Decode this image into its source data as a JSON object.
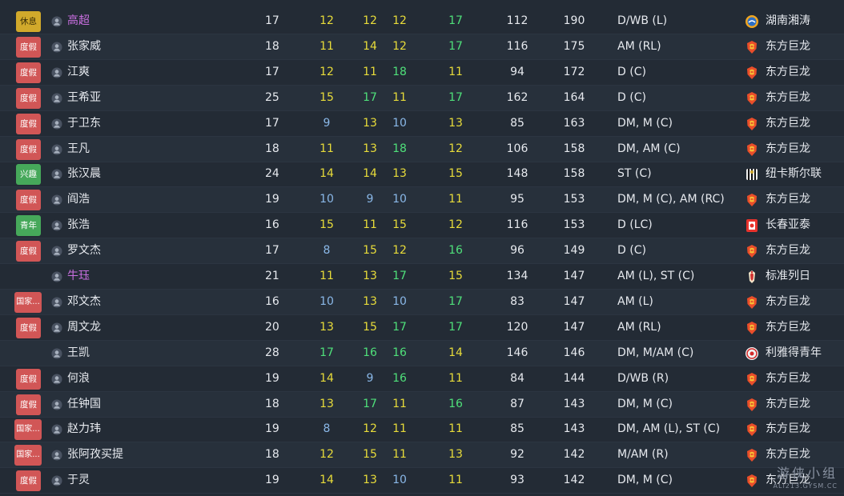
{
  "rows": [
    {
      "badge": "休息",
      "badge_type": "rest",
      "name": "高超",
      "purple": true,
      "age": "17",
      "a1": "12",
      "a1c": "yellow",
      "a2": "12",
      "a2c": "yellow",
      "a3": "12",
      "a3c": "yellow",
      "a4": "17",
      "a4c": "green",
      "v1": "112",
      "v2": "190",
      "pos": "D/WB (L)",
      "club": "湖南湘涛",
      "club_icon": "xiangtao"
    },
    {
      "badge": "度假",
      "badge_type": "vac",
      "name": "张家威",
      "purple": false,
      "age": "18",
      "a1": "11",
      "a1c": "yellow",
      "a2": "14",
      "a2c": "yellow",
      "a3": "12",
      "a3c": "yellow",
      "a4": "17",
      "a4c": "green",
      "v1": "116",
      "v2": "175",
      "pos": "AM (RL)",
      "club": "东方巨龙",
      "club_icon": "dragon"
    },
    {
      "badge": "度假",
      "badge_type": "vac",
      "name": "江爽",
      "purple": false,
      "age": "17",
      "a1": "12",
      "a1c": "yellow",
      "a2": "11",
      "a2c": "yellow",
      "a3": "18",
      "a3c": "green",
      "a4": "11",
      "a4c": "yellow",
      "v1": "94",
      "v2": "172",
      "pos": "D (C)",
      "club": "东方巨龙",
      "club_icon": "dragon"
    },
    {
      "badge": "度假",
      "badge_type": "vac",
      "name": "王希亚",
      "purple": false,
      "age": "25",
      "a1": "15",
      "a1c": "yellow",
      "a2": "17",
      "a2c": "green",
      "a3": "11",
      "a3c": "yellow",
      "a4": "17",
      "a4c": "green",
      "v1": "162",
      "v2": "164",
      "pos": "D (C)",
      "club": "东方巨龙",
      "club_icon": "dragon"
    },
    {
      "badge": "度假",
      "badge_type": "vac",
      "name": "于卫东",
      "purple": false,
      "age": "17",
      "a1": "9",
      "a1c": "blue",
      "a2": "13",
      "a2c": "yellow",
      "a3": "10",
      "a3c": "blue",
      "a4": "13",
      "a4c": "yellow",
      "v1": "85",
      "v2": "163",
      "pos": "DM, M (C)",
      "club": "东方巨龙",
      "club_icon": "dragon"
    },
    {
      "badge": "度假",
      "badge_type": "vac",
      "name": "王凡",
      "purple": false,
      "age": "18",
      "a1": "11",
      "a1c": "yellow",
      "a2": "13",
      "a2c": "yellow",
      "a3": "18",
      "a3c": "green",
      "a4": "12",
      "a4c": "yellow",
      "v1": "106",
      "v2": "158",
      "pos": "DM, AM (C)",
      "club": "东方巨龙",
      "club_icon": "dragon"
    },
    {
      "badge": "兴趣",
      "badge_type": "int",
      "name": "张汉晨",
      "purple": false,
      "age": "24",
      "a1": "14",
      "a1c": "yellow",
      "a2": "14",
      "a2c": "yellow",
      "a3": "13",
      "a3c": "yellow",
      "a4": "15",
      "a4c": "yellow",
      "v1": "148",
      "v2": "158",
      "pos": "ST (C)",
      "club": "纽卡斯尔联",
      "club_icon": "newcastle"
    },
    {
      "badge": "度假",
      "badge_type": "vac",
      "name": "阎浩",
      "purple": false,
      "age": "19",
      "a1": "10",
      "a1c": "blue",
      "a2": "9",
      "a2c": "blue",
      "a3": "10",
      "a3c": "blue",
      "a4": "11",
      "a4c": "yellow",
      "v1": "95",
      "v2": "153",
      "pos": "DM, M (C), AM (RC)",
      "club": "东方巨龙",
      "club_icon": "dragon"
    },
    {
      "badge": "青年",
      "badge_type": "youth",
      "name": "张浩",
      "purple": false,
      "age": "16",
      "a1": "15",
      "a1c": "yellow",
      "a2": "11",
      "a2c": "yellow",
      "a3": "15",
      "a3c": "yellow",
      "a4": "12",
      "a4c": "yellow",
      "v1": "116",
      "v2": "153",
      "pos": "D (LC)",
      "club": "长春亚泰",
      "club_icon": "yatai"
    },
    {
      "badge": "度假",
      "badge_type": "vac",
      "name": "罗文杰",
      "purple": false,
      "age": "17",
      "a1": "8",
      "a1c": "blue",
      "a2": "15",
      "a2c": "yellow",
      "a3": "12",
      "a3c": "yellow",
      "a4": "16",
      "a4c": "green",
      "v1": "96",
      "v2": "149",
      "pos": "D (C)",
      "club": "东方巨龙",
      "club_icon": "dragon"
    },
    {
      "badge": "",
      "badge_type": "",
      "name": "牛珏",
      "purple": true,
      "age": "21",
      "a1": "11",
      "a1c": "yellow",
      "a2": "13",
      "a2c": "yellow",
      "a3": "17",
      "a3c": "green",
      "a4": "15",
      "a4c": "yellow",
      "v1": "134",
      "v2": "147",
      "pos": "AM (L), ST (C)",
      "club": "标准列日",
      "club_icon": "liege"
    },
    {
      "badge": "国家...",
      "badge_type": "intl",
      "name": "邓文杰",
      "purple": false,
      "age": "16",
      "a1": "10",
      "a1c": "blue",
      "a2": "13",
      "a2c": "yellow",
      "a3": "10",
      "a3c": "blue",
      "a4": "17",
      "a4c": "green",
      "v1": "83",
      "v2": "147",
      "pos": "AM (L)",
      "club": "东方巨龙",
      "club_icon": "dragon"
    },
    {
      "badge": "度假",
      "badge_type": "vac",
      "name": "周文龙",
      "purple": false,
      "age": "20",
      "a1": "13",
      "a1c": "yellow",
      "a2": "15",
      "a2c": "yellow",
      "a3": "17",
      "a3c": "green",
      "a4": "17",
      "a4c": "green",
      "v1": "120",
      "v2": "147",
      "pos": "AM (RL)",
      "club": "东方巨龙",
      "club_icon": "dragon"
    },
    {
      "badge": "",
      "badge_type": "",
      "name": "王凯",
      "purple": false,
      "age": "28",
      "a1": "17",
      "a1c": "green",
      "a2": "16",
      "a2c": "green",
      "a3": "16",
      "a3c": "green",
      "a4": "14",
      "a4c": "yellow",
      "v1": "146",
      "v2": "146",
      "pos": "DM, M/AM (C)",
      "club": "利雅得青年",
      "club_icon": "shabab"
    },
    {
      "badge": "度假",
      "badge_type": "vac",
      "name": "何浪",
      "purple": false,
      "age": "19",
      "a1": "14",
      "a1c": "yellow",
      "a2": "9",
      "a2c": "blue",
      "a3": "16",
      "a3c": "green",
      "a4": "11",
      "a4c": "yellow",
      "v1": "84",
      "v2": "144",
      "pos": "D/WB (R)",
      "club": "东方巨龙",
      "club_icon": "dragon"
    },
    {
      "badge": "度假",
      "badge_type": "vac",
      "name": "任钟国",
      "purple": false,
      "age": "18",
      "a1": "13",
      "a1c": "yellow",
      "a2": "17",
      "a2c": "green",
      "a3": "11",
      "a3c": "yellow",
      "a4": "16",
      "a4c": "green",
      "v1": "87",
      "v2": "143",
      "pos": "DM, M (C)",
      "club": "东方巨龙",
      "club_icon": "dragon"
    },
    {
      "badge": "国家...",
      "badge_type": "intl",
      "name": "赵力玮",
      "purple": false,
      "age": "19",
      "a1": "8",
      "a1c": "blue",
      "a2": "12",
      "a2c": "yellow",
      "a3": "11",
      "a3c": "yellow",
      "a4": "11",
      "a4c": "yellow",
      "v1": "85",
      "v2": "143",
      "pos": "DM, AM (L), ST (C)",
      "club": "东方巨龙",
      "club_icon": "dragon"
    },
    {
      "badge": "国家...",
      "badge_type": "intl",
      "name": "张阿孜买提",
      "purple": false,
      "age": "18",
      "a1": "12",
      "a1c": "yellow",
      "a2": "15",
      "a2c": "yellow",
      "a3": "11",
      "a3c": "yellow",
      "a4": "13",
      "a4c": "yellow",
      "v1": "92",
      "v2": "142",
      "pos": "M/AM (R)",
      "club": "东方巨龙",
      "club_icon": "dragon"
    },
    {
      "badge": "度假",
      "badge_type": "vac",
      "name": "于灵",
      "purple": false,
      "age": "19",
      "a1": "14",
      "a1c": "yellow",
      "a2": "13",
      "a2c": "yellow",
      "a3": "10",
      "a3c": "blue",
      "a4": "11",
      "a4c": "yellow",
      "v1": "93",
      "v2": "142",
      "pos": "DM, M (C)",
      "club": "东方巨龙",
      "club_icon": "dragon"
    }
  ],
  "watermark": {
    "main": "游侠小组",
    "sub": "ALI213.GYSM.CC"
  },
  "colors": {
    "yellow": "#e8dc3a",
    "green": "#4fe07a",
    "blue": "#8ab8e8",
    "purple": "#c96fe0",
    "background": "#232b35"
  }
}
